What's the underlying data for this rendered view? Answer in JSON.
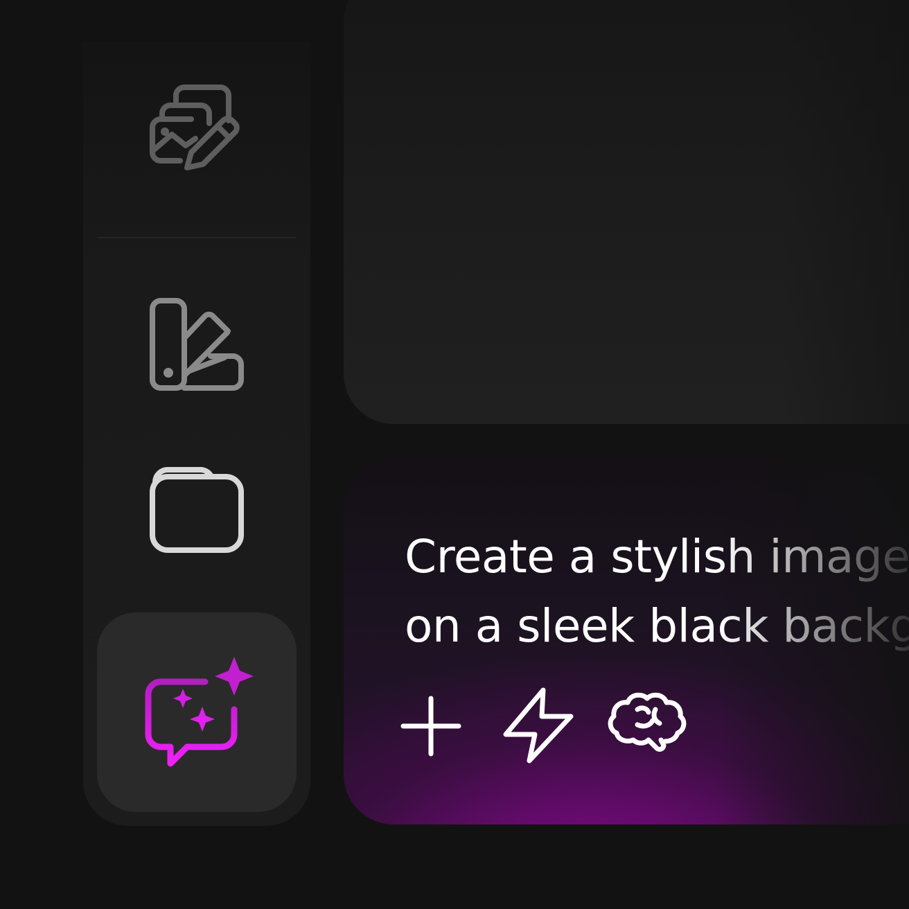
{
  "sidebar": {
    "items": [
      {
        "id": "image-edit",
        "icon": "image-edit-icon",
        "color": "#6a6a6a"
      },
      {
        "id": "swatches",
        "icon": "color-swatch-icon",
        "color": "#8a8a8a"
      },
      {
        "id": "folder",
        "icon": "folder-icon",
        "color": "#d8d8d8"
      },
      {
        "id": "ai-chat",
        "icon": "ai-chat-sparkle-icon",
        "color": "#e020e8",
        "active": true
      }
    ]
  },
  "prompt": {
    "line1": "Create a stylish image",
    "line2": "on a sleek black background",
    "actions": [
      {
        "id": "add",
        "icon": "plus-icon"
      },
      {
        "id": "fast",
        "icon": "lightning-icon"
      },
      {
        "id": "think",
        "icon": "brain-icon"
      }
    ]
  },
  "colors": {
    "background": "#121212",
    "accent": "#e020e8",
    "accent_deep": "#8a0a8e"
  }
}
